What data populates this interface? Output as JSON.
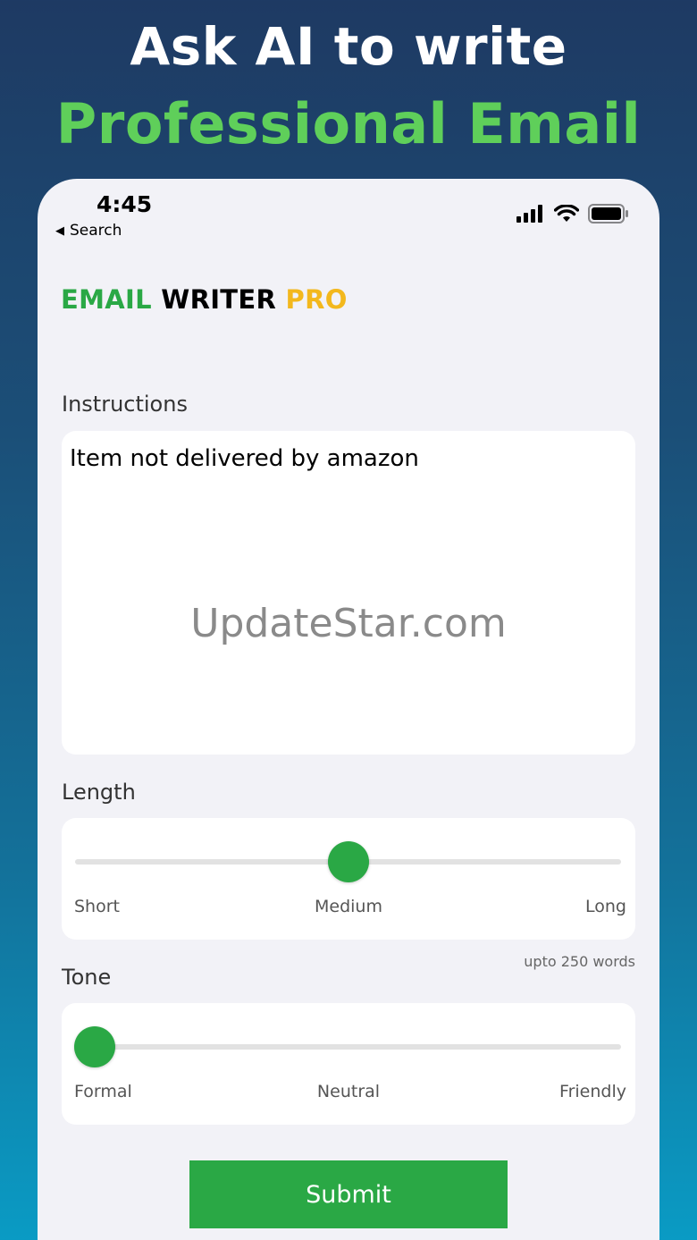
{
  "headline": {
    "line1": "Ask AI to write",
    "line2": "Professional Email"
  },
  "status_bar": {
    "time": "4:45",
    "back_label": "Search"
  },
  "app_title": {
    "part1": "EMAIL",
    "part2": "WRITER",
    "part3": "PRO"
  },
  "instructions": {
    "label": "Instructions",
    "value": "Item not delivered by amazon",
    "watermark": "UpdateStar.com"
  },
  "length": {
    "label": "Length",
    "options": [
      "Short",
      "Medium",
      "Long"
    ],
    "selected_index": 1,
    "value_fraction": 0.5,
    "note": "upto 250 words"
  },
  "tone": {
    "label": "Tone",
    "options": [
      "Formal",
      "Neutral",
      "Friendly"
    ],
    "selected_index": 0,
    "value_fraction": 0.0
  },
  "submit_label": "Submit",
  "colors": {
    "accent_green": "#2aa845",
    "title_yellow": "#f3b81d",
    "headline_green": "#5fcf5a"
  }
}
